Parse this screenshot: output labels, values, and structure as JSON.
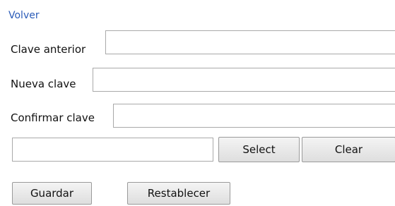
{
  "nav": {
    "back_link": "Volver"
  },
  "form": {
    "old_password": {
      "label": "Clave anterior",
      "value": ""
    },
    "new_password": {
      "label": "Nueva clave",
      "value": ""
    },
    "confirm_password": {
      "label": "Confirmar clave",
      "value": ""
    },
    "file_picker": {
      "value": "",
      "select_label": "Select",
      "clear_label": "Clear"
    }
  },
  "actions": {
    "save_label": "Guardar",
    "reset_label": "Restablecer"
  }
}
